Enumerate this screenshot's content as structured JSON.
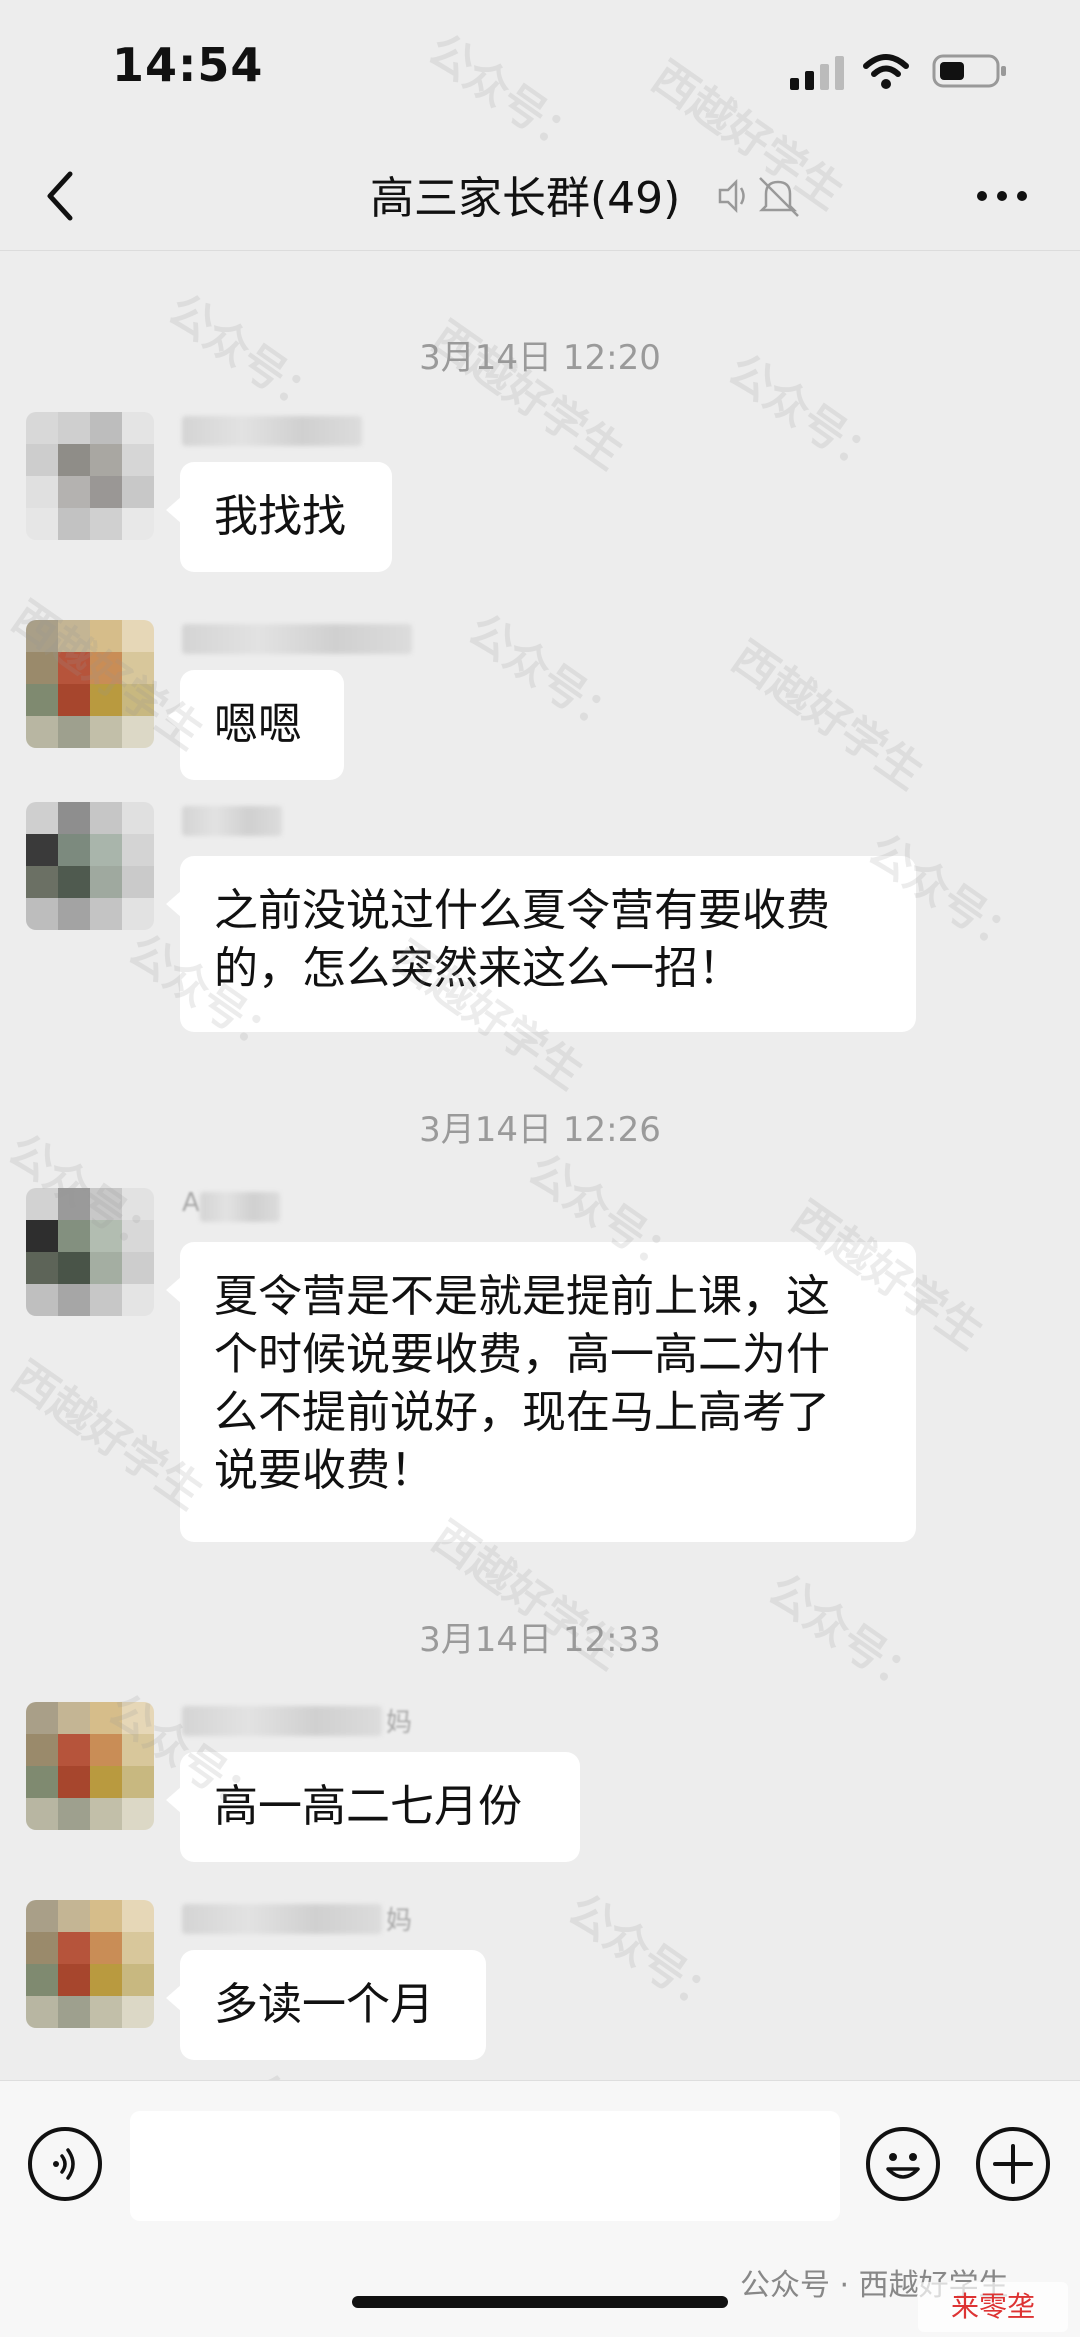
{
  "status_bar": {
    "time": "14:54"
  },
  "nav": {
    "title": "高三家长群(49)"
  },
  "chat": {
    "timestamps": [
      "3月14日 12:20",
      "3月14日 12:26",
      "3月14日 12:33"
    ],
    "messages": [
      {
        "text": "我找找"
      },
      {
        "text": "嗯嗯"
      },
      {
        "text_lines": [
          "之前没说过什么夏令营有要收费",
          "的，怎么突然来这么一招！"
        ]
      },
      {
        "sender": "A",
        "text_lines": [
          "夏令营是不是就是提前上课，这",
          "个时候说要收费，高一高二为什",
          "么不提前说好，现在马上高考了",
          "说要收费！"
        ]
      },
      {
        "sender_suffix": "妈",
        "text": "高一高二七月份"
      },
      {
        "sender_suffix": "妈",
        "text": "多读一个月"
      }
    ]
  },
  "watermark": {
    "line1": "公众号：",
    "line2": "西越好学生"
  },
  "input_bar": {
    "placeholder": ""
  },
  "footer": {
    "source": "公众号 · 西越好学生",
    "logo": "来零垄"
  },
  "colors": {
    "background": "#ededed",
    "bubble": "#ffffff",
    "timestamp": "#9a9a9a"
  },
  "icons": [
    "back-icon",
    "speaker-icon",
    "mute-bell-icon",
    "more-icon",
    "voice-icon",
    "emoji-icon",
    "plus-icon",
    "signal-icon",
    "wifi-icon",
    "battery-icon"
  ]
}
